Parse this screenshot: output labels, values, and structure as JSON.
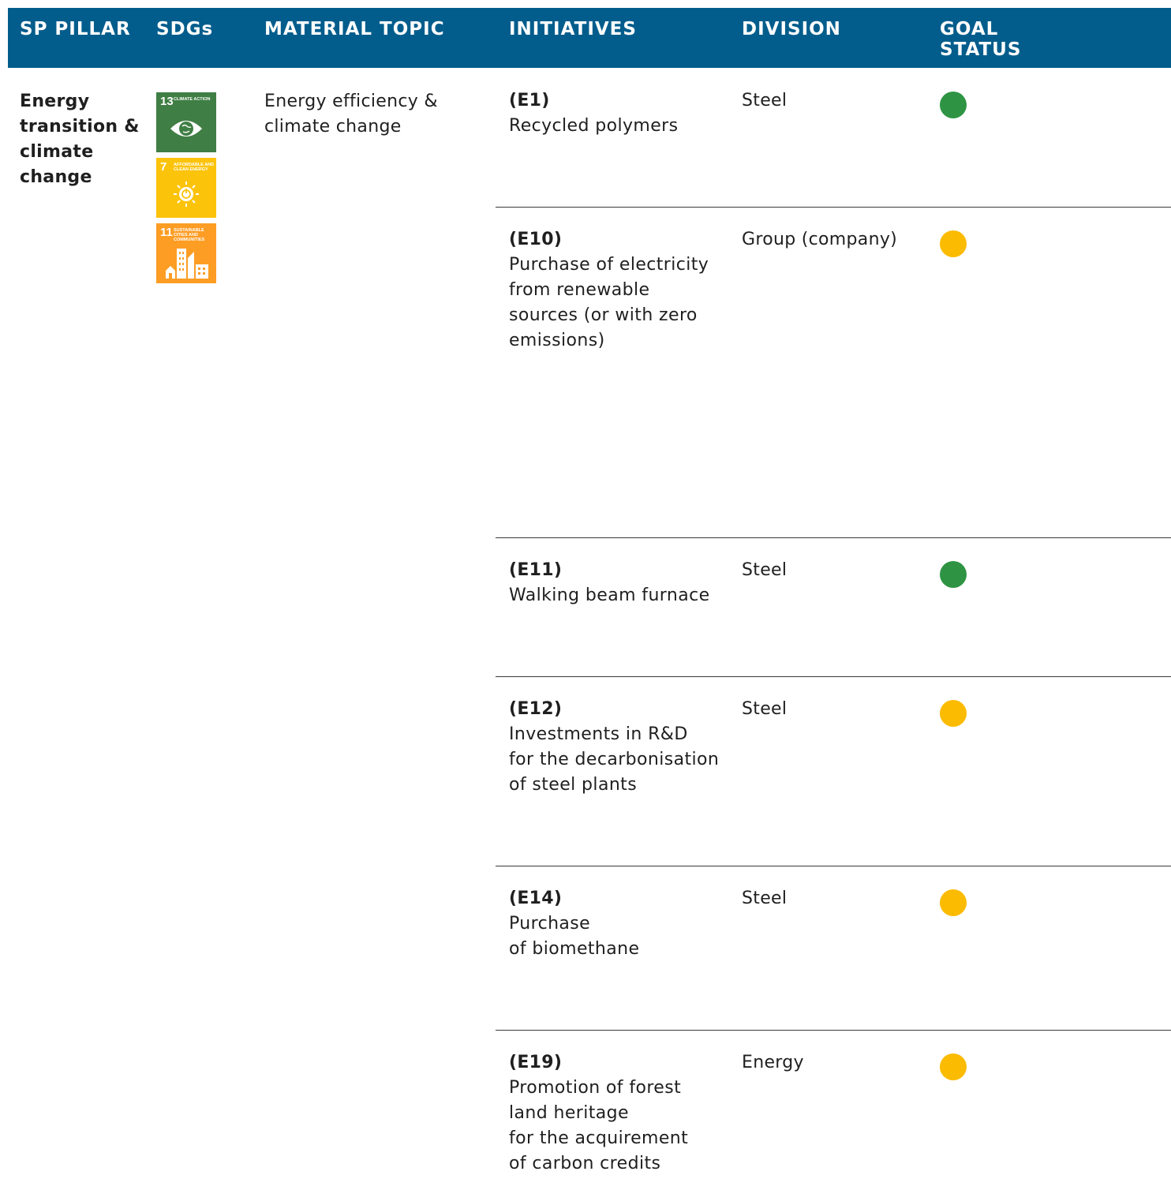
{
  "header": {
    "pillar": "SP PILLAR",
    "sdgs": "SDGs",
    "topic": "MATERIAL TOPIC",
    "initiatives": "INITIATIVES",
    "division": "DIVISION",
    "goal_status_line1": "GOAL",
    "goal_status_line2": "STATUS"
  },
  "pillar": "Energy transition & climate change",
  "material_topic": "Energy efficiency & climate change",
  "sdgs": [
    {
      "number": "13",
      "label": "CLIMATE ACTION",
      "color": "#3f7e44",
      "icon": "eye-globe-icon"
    },
    {
      "number": "7",
      "label": "AFFORDABLE AND CLEAN ENERGY",
      "color": "#fcc30b",
      "icon": "sun-power-icon"
    },
    {
      "number": "11",
      "label": "SUSTAINABLE CITIES AND COMMUNITIES",
      "color": "#fd9d24",
      "icon": "city-buildings-icon"
    }
  ],
  "status_colors": {
    "green": "#2e9443",
    "yellow": "#fbbb00"
  },
  "initiatives": [
    {
      "code": "(E1)",
      "description": "Recycled polymers",
      "division": "Steel",
      "status": "green"
    },
    {
      "code": "(E10)",
      "description": "Purchase of electricity\nfrom renewable\nsources (or with zero\nemissions)",
      "division": "Group (company)",
      "status": "yellow"
    },
    {
      "code": "(E11)",
      "description": "Walking beam furnace",
      "division": "Steel",
      "status": "green"
    },
    {
      "code": "(E12)",
      "description": "Investments in R&D\nfor the decarbonisation\nof steel plants",
      "division": "Steel",
      "status": "yellow"
    },
    {
      "code": "(E14)",
      "description": "Purchase\nof biomethane",
      "division": "Steel",
      "status": "yellow"
    },
    {
      "code": "(E19)",
      "description": "Promotion of forest\nland heritage\nfor the acquirement\nof carbon credits",
      "division": "Energy",
      "status": "yellow"
    }
  ]
}
